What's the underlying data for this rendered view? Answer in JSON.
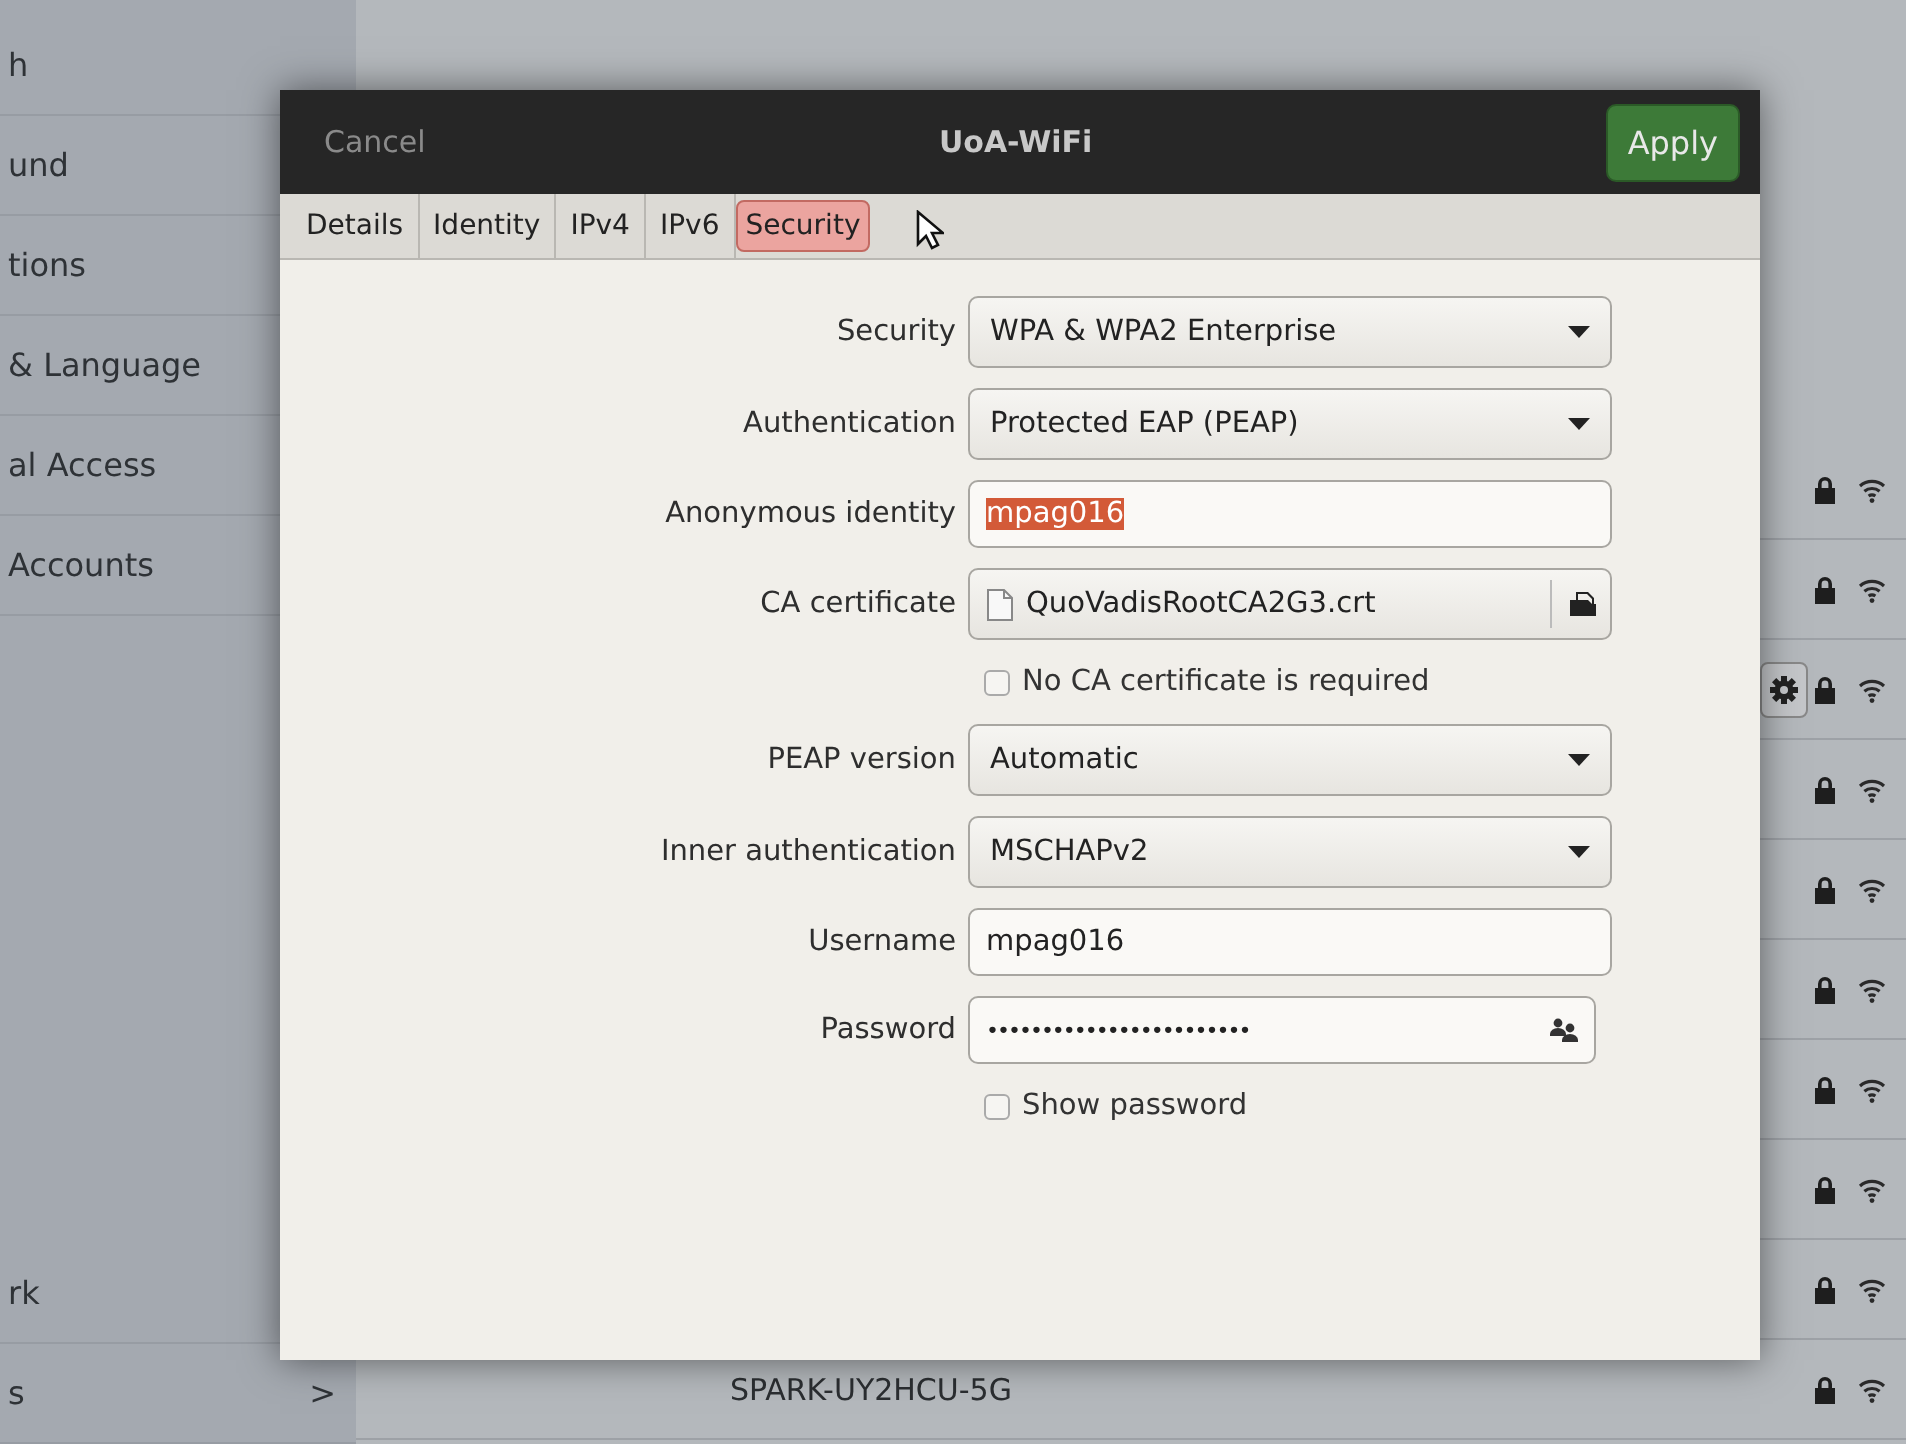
{
  "background": {
    "sidebar": {
      "items": [
        {
          "label": "h"
        },
        {
          "label": "und"
        },
        {
          "label": "tions"
        },
        {
          "label": "& Language"
        },
        {
          "label": "al Access"
        },
        {
          "label": "Accounts"
        },
        {
          "label": "rk"
        },
        {
          "label": "s",
          "chevron": ">"
        }
      ]
    },
    "networks": [
      {
        "secured": true,
        "connected": false
      },
      {
        "secured": true,
        "connected": false
      },
      {
        "secured": true,
        "connected": true
      },
      {
        "secured": true,
        "connected": false
      },
      {
        "secured": true,
        "connected": false
      },
      {
        "secured": true,
        "connected": false
      },
      {
        "secured": true,
        "connected": false
      },
      {
        "secured": true,
        "connected": false
      },
      {
        "secured": true,
        "connected": false
      },
      {
        "secured": true,
        "connected": false,
        "name": "SPARK-UY2HCU-5G"
      }
    ]
  },
  "dialog": {
    "cancel": "Cancel",
    "title": "UoA-WiFi",
    "apply": "Apply",
    "tabs": [
      {
        "label": "Details",
        "selected": false
      },
      {
        "label": "Identity",
        "selected": false
      },
      {
        "label": "IPv4",
        "selected": false
      },
      {
        "label": "IPv6",
        "selected": false
      },
      {
        "label": "Security",
        "selected": true
      }
    ],
    "form": [
      {
        "kind": "dropdown",
        "label": "Security",
        "value": "WPA & WPA2 Enterprise"
      },
      {
        "kind": "dropdown",
        "label": "Authentication",
        "value": "Protected EAP (PEAP)"
      },
      {
        "kind": "entry",
        "label": "Anonymous identity",
        "value": "mpag016",
        "text_selected": true
      },
      {
        "kind": "file",
        "label": "CA certificate",
        "value": "QuoVadisRootCA2G3.crt"
      },
      {
        "kind": "checkbox",
        "label": "No CA certificate is required",
        "checked": false
      },
      {
        "kind": "dropdown",
        "label": "PEAP version",
        "value": "Automatic"
      },
      {
        "kind": "dropdown",
        "label": "Inner authentication",
        "value": "MSCHAPv2"
      },
      {
        "kind": "entry",
        "label": "Username",
        "value": "mpag016",
        "text_selected": false
      },
      {
        "kind": "password",
        "label": "Password",
        "value": "••••••••••••••••••••••••"
      },
      {
        "kind": "checkbox",
        "label": "Show password",
        "checked": false
      }
    ]
  }
}
